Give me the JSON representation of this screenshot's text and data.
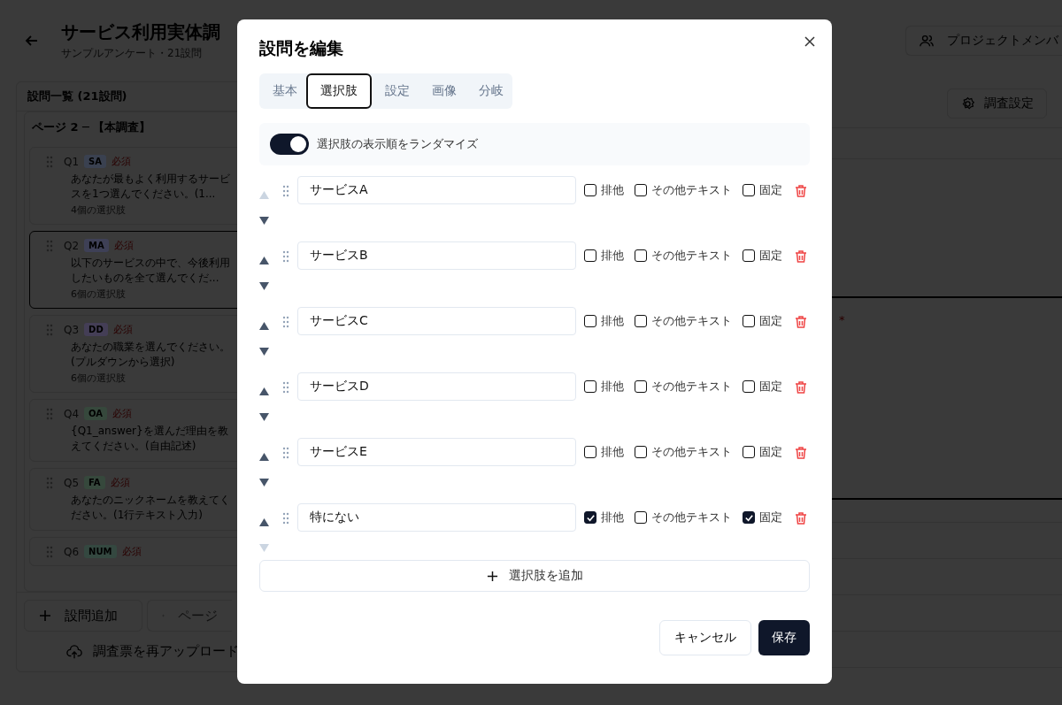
{
  "header": {
    "title": "サービス利用実体調",
    "subtitle": "サンプルアンケート・21設問",
    "members_button": "プロジェクトメンバ"
  },
  "toolbar": {
    "settings_button": "調査設定"
  },
  "editor": {
    "required_mark": "*"
  },
  "question_list": {
    "title": "設問一覧 (21設問)",
    "page_label": "ページ 2 ─ 【本調査】",
    "questions": [
      {
        "number": "Q1",
        "type": "SA",
        "color": "#3a4150",
        "required": "必須",
        "text": "あなたが最もよく利用するサービスを1つ選んでください。(1...",
        "meta": "4個の選択肢",
        "selected": false
      },
      {
        "number": "Q2",
        "type": "MA",
        "color": "#3e4056",
        "required": "必須",
        "text": "以下のサービスの中で、今後利用したいものを全て選んでくだ...",
        "meta": "6個の選択肢",
        "selected": true
      },
      {
        "number": "Q3",
        "type": "DD",
        "color": "#443e56",
        "required": "必須",
        "text": "あなたの職業を選んでください。(プルダウンから選択)",
        "meta": "6個の選択肢",
        "selected": false
      },
      {
        "number": "Q4",
        "type": "OA",
        "color": "#36483c",
        "required": "必須",
        "text": "{Q1_answer}を選んだ理由を教えてください。(自由記述)",
        "selected": false
      },
      {
        "number": "Q5",
        "type": "FA",
        "color": "#36483c",
        "required": "必須",
        "text": "あなたのニックネームを教えてください。(1行テキスト入力)",
        "selected": false
      },
      {
        "number": "Q6",
        "type": "NUM",
        "color": "#344840",
        "required": "必須",
        "selected": false
      }
    ],
    "add_question_button": "設問追加",
    "add_page_button": "ページ",
    "reupload_link": "調査票を再アップロード"
  },
  "dialog": {
    "title": "設問を編集",
    "tabs": [
      {
        "label": "基本",
        "selected": false
      },
      {
        "label": "選択肢",
        "selected": true
      },
      {
        "label": "設定",
        "selected": false
      },
      {
        "label": "画像",
        "selected": false
      },
      {
        "label": "分岐",
        "selected": false
      }
    ],
    "randomize": {
      "label": "選択肢の表示順をランダマイズ",
      "on": true
    },
    "options": [
      {
        "value": "サービスA",
        "up_disabled": true,
        "down_disabled": false,
        "flags": [
          {
            "label": "排他",
            "checked": false
          },
          {
            "label": "その他テキスト",
            "checked": false
          },
          {
            "label": "固定",
            "checked": false
          }
        ]
      },
      {
        "value": "サービスB",
        "up_disabled": false,
        "down_disabled": false,
        "flags": [
          {
            "label": "排他",
            "checked": false
          },
          {
            "label": "その他テキスト",
            "checked": false
          },
          {
            "label": "固定",
            "checked": false
          }
        ]
      },
      {
        "value": "サービスC",
        "up_disabled": false,
        "down_disabled": false,
        "flags": [
          {
            "label": "排他",
            "checked": false
          },
          {
            "label": "その他テキスト",
            "checked": false
          },
          {
            "label": "固定",
            "checked": false
          }
        ]
      },
      {
        "value": "サービスD",
        "up_disabled": false,
        "down_disabled": false,
        "flags": [
          {
            "label": "排他",
            "checked": false
          },
          {
            "label": "その他テキスト",
            "checked": false
          },
          {
            "label": "固定",
            "checked": false
          }
        ]
      },
      {
        "value": "サービスE",
        "up_disabled": false,
        "down_disabled": false,
        "flags": [
          {
            "label": "排他",
            "checked": false
          },
          {
            "label": "その他テキスト",
            "checked": false
          },
          {
            "label": "固定",
            "checked": false
          }
        ]
      },
      {
        "value": "特にない",
        "up_disabled": false,
        "down_disabled": true,
        "flags": [
          {
            "label": "排他",
            "checked": true
          },
          {
            "label": "その他テキスト",
            "checked": false
          },
          {
            "label": "固定",
            "checked": true
          }
        ]
      }
    ],
    "add_option_button": "選択肢を追加",
    "cancel_button": "キャンセル",
    "save_button": "保存"
  }
}
